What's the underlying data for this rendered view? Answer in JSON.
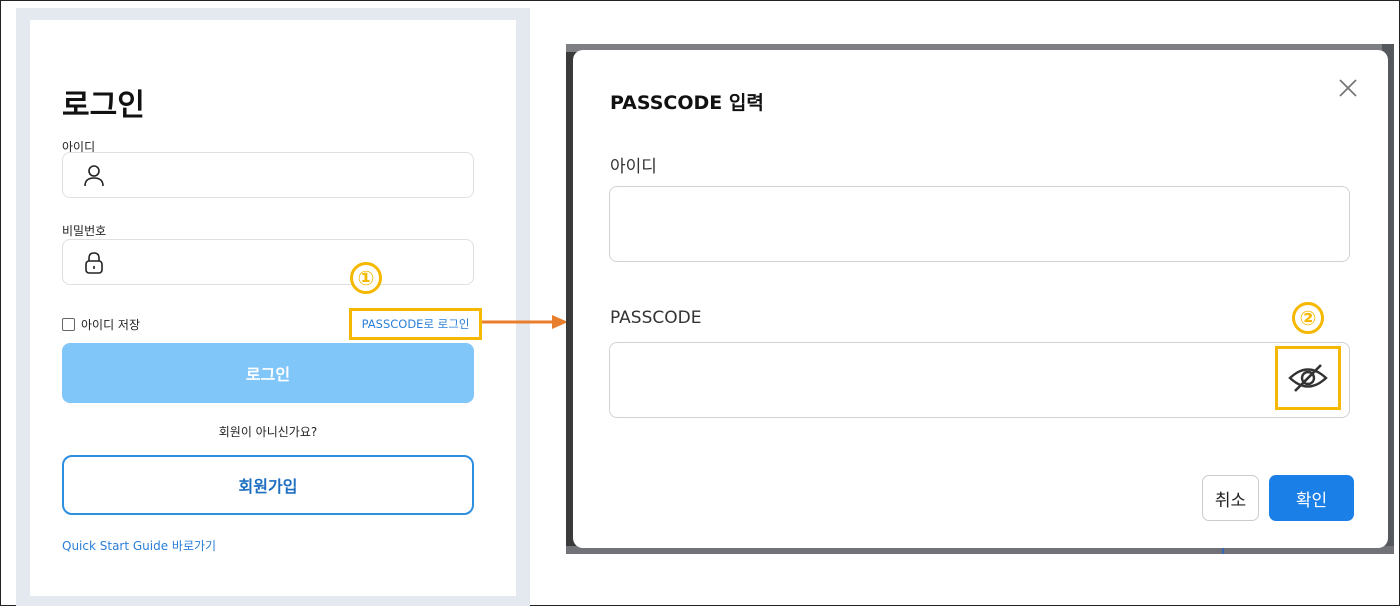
{
  "login": {
    "title": "로그인",
    "id_label": "아이디",
    "password_label": "비밀번호",
    "remember_label": "아이디 저장",
    "passcode_link": "PASSCODE로 로그인",
    "login_button": "로그인",
    "not_member": "회원이 아니신가요?",
    "signup_button": "회원가입",
    "guide_link": "Quick Start Guide 바로가기"
  },
  "annotations": {
    "step1": "①",
    "step2": "②",
    "highlight_color": "#f5b800",
    "arrow_color": "#e87d2c"
  },
  "dialog": {
    "title": "PASSCODE 입력",
    "id_label": "아이디",
    "passcode_label": "PASSCODE",
    "cancel_button": "취소",
    "confirm_button": "확인"
  },
  "icons": {
    "id_field": "user-icon",
    "password_field": "lock-icon",
    "toggle_visibility": "eye-off-icon",
    "close": "close-icon"
  },
  "colors": {
    "primary": "#1b7fe8",
    "login_button_disabled": "#80c6f9",
    "link": "#2a7fd8"
  }
}
